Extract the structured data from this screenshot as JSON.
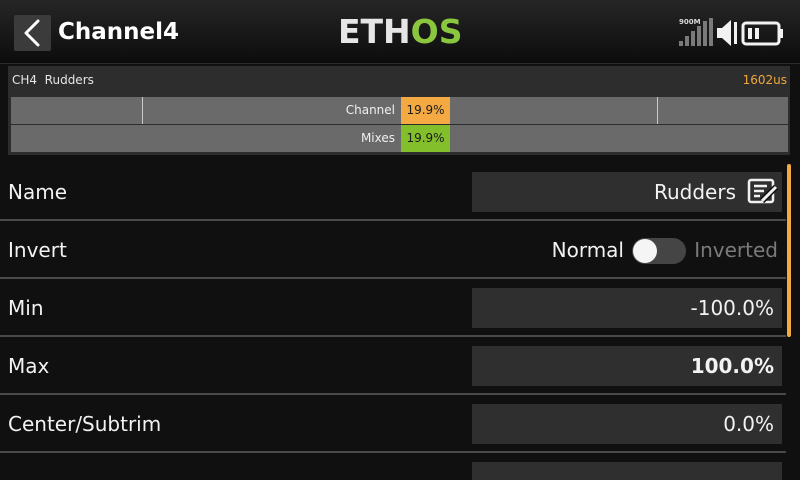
{
  "header": {
    "title": "Channel4",
    "logo_part1": "ETH",
    "logo_part2": "OS",
    "logo_colors": {
      "main": "#e6e6e6",
      "accent": "#8bc63f"
    },
    "signal_label": "900M",
    "icons": [
      "back-arrow-icon",
      "signal-bars-icon",
      "speaker-icon",
      "battery-icon"
    ]
  },
  "monitor": {
    "title": "CH4  Rudders",
    "output_value": "1602us",
    "rows": [
      {
        "label": "Channel",
        "value": "19.9%",
        "color": "#f4a943"
      },
      {
        "label": "Mixes",
        "value": "19.9%",
        "color": "#82bf2a"
      }
    ]
  },
  "settings": {
    "name": {
      "label": "Name",
      "value": "Rudders"
    },
    "invert": {
      "label": "Invert",
      "option_off": "Normal",
      "option_on": "Inverted",
      "state": false
    },
    "min": {
      "label": "Min",
      "value": "-100.0%"
    },
    "max": {
      "label": "Max",
      "value": "100.0%"
    },
    "center": {
      "label": "Center/Subtrim",
      "value": "0.0%"
    }
  },
  "accent_color": "#f4a943"
}
